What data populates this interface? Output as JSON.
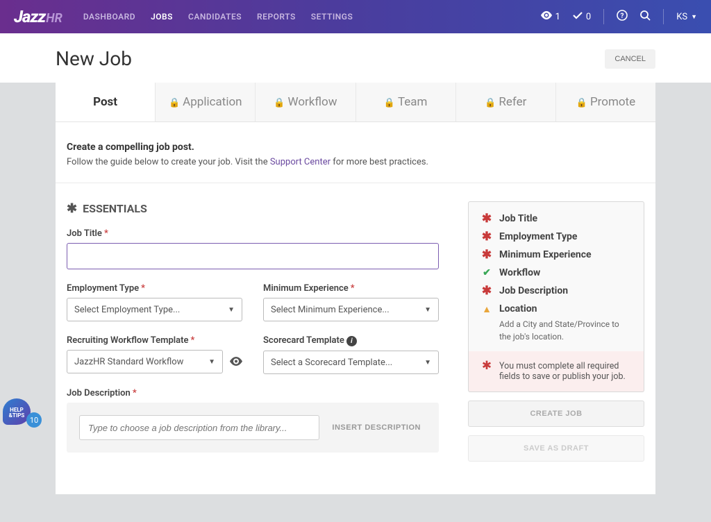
{
  "brand": {
    "name": "Jazz",
    "suffix": "HR"
  },
  "nav": {
    "items": [
      {
        "label": "DASHBOARD",
        "active": false
      },
      {
        "label": "JOBS",
        "active": true
      },
      {
        "label": "CANDIDATES",
        "active": false
      },
      {
        "label": "REPORTS",
        "active": false
      },
      {
        "label": "SETTINGS",
        "active": false
      }
    ]
  },
  "topbar": {
    "views": "1",
    "checks": "0",
    "user": "KS"
  },
  "header": {
    "title": "New Job",
    "cancel": "CANCEL"
  },
  "tabs": [
    {
      "label": "Post",
      "locked": false,
      "active": true
    },
    {
      "label": "Application",
      "locked": true,
      "active": false
    },
    {
      "label": "Workflow",
      "locked": true,
      "active": false
    },
    {
      "label": "Team",
      "locked": true,
      "active": false
    },
    {
      "label": "Refer",
      "locked": true,
      "active": false
    },
    {
      "label": "Promote",
      "locked": true,
      "active": false
    }
  ],
  "guide": {
    "heading": "Create a compelling job post.",
    "pre": "Follow the guide below to create your job. Visit the ",
    "link": "Support Center",
    "post": " for more best practices."
  },
  "section": {
    "essentials": "ESSENTIALS"
  },
  "fields": {
    "job_title": {
      "label": "Job Title",
      "value": ""
    },
    "employment_type": {
      "label": "Employment Type",
      "placeholder": "Select Employment Type..."
    },
    "min_experience": {
      "label": "Minimum Experience",
      "placeholder": "Select Minimum Experience..."
    },
    "workflow_template": {
      "label": "Recruiting Workflow Template",
      "value": "JazzHR Standard Workflow"
    },
    "scorecard_template": {
      "label": "Scorecard Template",
      "placeholder": "Select a Scorecard Template..."
    },
    "job_description": {
      "label": "Job Description",
      "search_placeholder": "Type to choose a job description from the library...",
      "insert": "INSERT DESCRIPTION"
    }
  },
  "sidebar": {
    "items": [
      {
        "label": "Job Title",
        "state": "req"
      },
      {
        "label": "Employment Type",
        "state": "req"
      },
      {
        "label": "Minimum Experience",
        "state": "req"
      },
      {
        "label": "Workflow",
        "state": "ok"
      },
      {
        "label": "Job Description",
        "state": "req"
      },
      {
        "label": "Location",
        "state": "warn",
        "note": "Add a City and State/Province to the job's location."
      }
    ],
    "error": "You must complete all required fields to save or publish your job.",
    "create": "CREATE JOB",
    "save": "SAVE AS DRAFT"
  },
  "help": {
    "label": "HELP\n& TIPS",
    "count": "10"
  }
}
